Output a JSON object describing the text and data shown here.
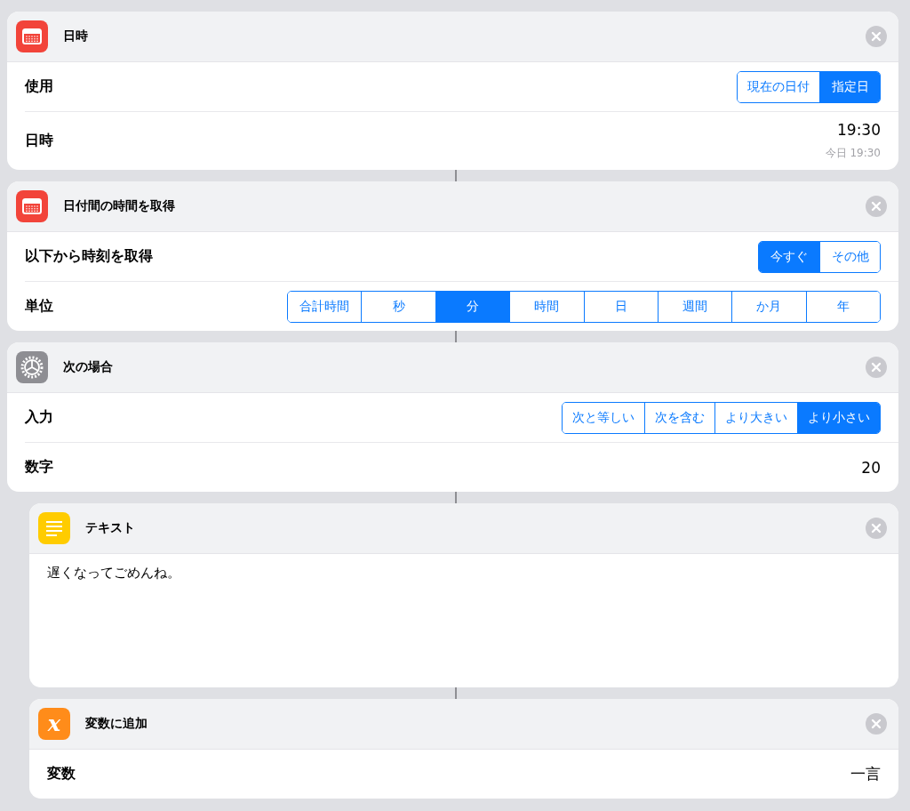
{
  "actions": [
    {
      "title": "日時",
      "kind": "calendar",
      "indent": false,
      "rows": [
        {
          "kind": "segmented",
          "label": "使用",
          "options": [
            {
              "label": "現在の日付",
              "selected": false
            },
            {
              "label": "指定日",
              "selected": true
            }
          ]
        },
        {
          "kind": "value",
          "label": "日時",
          "value": "19:30",
          "detail": "今日 19:30"
        }
      ]
    },
    {
      "title": "日付間の時間を取得",
      "kind": "calendar",
      "indent": false,
      "rows": [
        {
          "kind": "segmented",
          "label": "以下から時刻を取得",
          "options": [
            {
              "label": "今すぐ",
              "selected": true
            },
            {
              "label": "その他",
              "selected": false
            }
          ]
        },
        {
          "kind": "segmented",
          "label": "単位",
          "options": [
            {
              "label": "合計時間",
              "selected": false
            },
            {
              "label": "秒",
              "selected": false
            },
            {
              "label": "分",
              "selected": true
            },
            {
              "label": "時間",
              "selected": false
            },
            {
              "label": "日",
              "selected": false
            },
            {
              "label": "週間",
              "selected": false
            },
            {
              "label": "か月",
              "selected": false
            },
            {
              "label": "年",
              "selected": false
            }
          ]
        }
      ]
    },
    {
      "title": "次の場合",
      "kind": "gear",
      "indent": false,
      "rows": [
        {
          "kind": "segmented",
          "label": "入力",
          "options": [
            {
              "label": "次と等しい",
              "selected": false
            },
            {
              "label": "次を含む",
              "selected": false
            },
            {
              "label": "より大きい",
              "selected": false
            },
            {
              "label": "より小さい",
              "selected": true
            }
          ]
        },
        {
          "kind": "value",
          "label": "数字",
          "value": "20"
        }
      ]
    },
    {
      "title": "テキスト",
      "kind": "text",
      "indent": true,
      "rows": [
        {
          "kind": "text",
          "text": "遅くなってごめんね。"
        }
      ]
    },
    {
      "title": "変数に追加",
      "kind": "variable",
      "icon_text": "x",
      "indent": true,
      "rows": [
        {
          "kind": "value",
          "label": "変数",
          "value": "一言"
        }
      ]
    }
  ]
}
